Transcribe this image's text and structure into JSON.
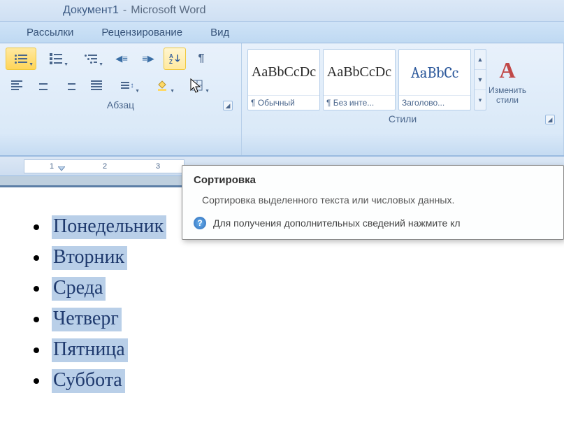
{
  "title": {
    "doc": "Документ1",
    "app": "Microsoft Word"
  },
  "tabs": {
    "mailings": "Рассылки",
    "review": "Рецензирование",
    "view": "Вид"
  },
  "paragraph": {
    "label": "Абзац"
  },
  "styles": {
    "label": "Стили",
    "sample": "AaBbCcDc",
    "sample_heading": "AaBbCc",
    "items": [
      {
        "name": "¶ Обычный"
      },
      {
        "name": "¶ Без инте..."
      },
      {
        "name": "Заголово..."
      }
    ],
    "change": "Изменить стили"
  },
  "ruler": {
    "marks": [
      "1",
      "2",
      "3"
    ]
  },
  "list": {
    "items": [
      "Понедельник",
      "Вторник",
      "Среда",
      "Четверг",
      "Пятница",
      "Суббота"
    ]
  },
  "tooltip": {
    "title": "Сортировка",
    "body": "Сортировка выделенного текста или числовых данных.",
    "help": "Для получения дополнительных сведений нажмите кл"
  }
}
